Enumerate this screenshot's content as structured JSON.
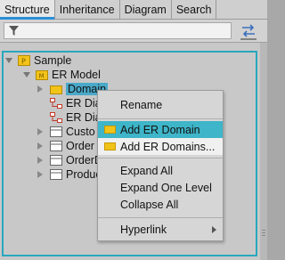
{
  "tabs": [
    {
      "label": "Structure",
      "active": true
    },
    {
      "label": "Inheritance",
      "active": false
    },
    {
      "label": "Diagram",
      "active": false
    },
    {
      "label": "Search",
      "active": false
    }
  ],
  "filter": {
    "value": "",
    "placeholder": ""
  },
  "tree": {
    "items": [
      {
        "label": "Sample",
        "icon": "project-icon",
        "expanded": true
      },
      {
        "label": "ER Model",
        "icon": "model-folder-icon",
        "expanded": true
      },
      {
        "label": "Domain",
        "icon": "folder-icon",
        "selected": true
      },
      {
        "label": "ER Dia",
        "icon": "er-diagram-icon"
      },
      {
        "label": "ER Dia",
        "icon": "er-diagram-icon"
      },
      {
        "label": "Custo",
        "icon": "entity-icon"
      },
      {
        "label": "Order",
        "icon": "entity-icon"
      },
      {
        "label": "OrderD",
        "icon": "entity-icon"
      },
      {
        "label": "Produc",
        "icon": "entity-icon"
      }
    ]
  },
  "context_menu": {
    "items": [
      {
        "label": "Rename"
      },
      {
        "label": "Add ER Domain",
        "icon": "folder-icon"
      },
      {
        "label": "Add ER Domains...",
        "icon": "folder-icon"
      },
      {
        "label": "Expand All"
      },
      {
        "label": "Expand One Level"
      },
      {
        "label": "Collapse All"
      },
      {
        "label": "Hyperlink",
        "submenu": true
      }
    ]
  },
  "colors": {
    "accent": "#2a8fd6",
    "selection": "#3eb5c8",
    "folder": "#f2c318"
  }
}
